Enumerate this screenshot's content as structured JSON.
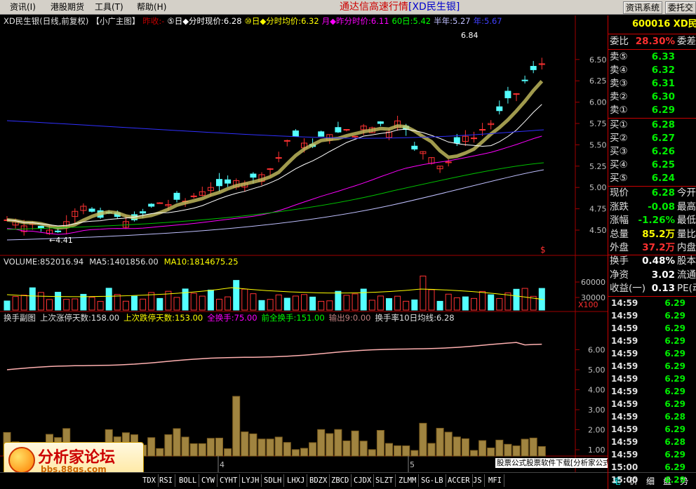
{
  "menubar": {
    "items": [
      "资讯(I)",
      "港股期货",
      "工具(T)",
      "帮助(H)"
    ],
    "app_title": "通达信高速行情",
    "app_title_stock": "[XD民生银]",
    "buttons": [
      "资讯系统",
      "委托交"
    ]
  },
  "chart_header": {
    "stock": "XD民生银(日线,前复权)",
    "template": "【小广主图】",
    "prev_close_label": "昨收:-",
    "fsxj": "⑤日◆分时现价:6.28",
    "fsjj": "⑩日◆分时均价:6.32",
    "zrjj": "月◆昨分时价:6.11",
    "sixty": "60日:5.42",
    "halfyear": "半年:5.27",
    "year": "年:5.67"
  },
  "price_axis": [
    "6.50",
    "6.25",
    "6.00",
    "5.75",
    "5.50",
    "5.25",
    "5.00",
    "4.75",
    "4.50"
  ],
  "annotations": {
    "high": "6.84",
    "low": "4.41",
    "dollar": "$"
  },
  "volume_header": {
    "volume": "VOLUME:852016.94",
    "ma5": "MA5:1401856.00",
    "ma10": "MA10:1814675.25"
  },
  "volume_axis": [
    "60000",
    "30000"
  ],
  "volume_unit": "X100",
  "indicator_header": {
    "name": "换手副图",
    "up": "上次涨停天数:158.00",
    "down": "上次跌停天数:153.00",
    "full": "全换手:75.00",
    "prev_full": "前全换手:151.00",
    "out": "输出9:0.00",
    "rate": "换手率10日均线:6.28"
  },
  "indicator_axis": [
    "6.00",
    "5.00",
    "4.00",
    "3.00",
    "2.00",
    "1.00"
  ],
  "month_markers": [
    "4",
    "5"
  ],
  "tabs": [
    "TDX",
    "RSI",
    "BOLL",
    "CYW",
    "CYHT",
    "LYJH",
    "SDLH",
    "LHXJ",
    "BDZX",
    "ZBCD",
    "CJDX",
    "SLZT",
    "ZLMM",
    "SG-LB",
    "ACCER",
    "JS",
    "MFI"
  ],
  "watermark": {
    "title": "分析家论坛",
    "url": "bbs.88gs.com"
  },
  "promo": "股票公式股票软件下载[分析家公式网www.88gs.com]",
  "quote": {
    "code": "600016 XD民",
    "weibi_label": "委比",
    "weibi": "28.30%",
    "weibi_extra": "委差",
    "asks": [
      {
        "label": "卖⑤",
        "price": "6.33"
      },
      {
        "label": "卖④",
        "price": "6.32"
      },
      {
        "label": "卖③",
        "price": "6.31"
      },
      {
        "label": "卖②",
        "price": "6.30"
      },
      {
        "label": "卖①",
        "price": "6.29"
      }
    ],
    "bids": [
      {
        "label": "买①",
        "price": "6.28"
      },
      {
        "label": "买②",
        "price": "6.27"
      },
      {
        "label": "买③",
        "price": "6.26"
      },
      {
        "label": "买④",
        "price": "6.25"
      },
      {
        "label": "买⑤",
        "price": "6.24"
      }
    ],
    "stats": [
      {
        "label": "现价",
        "value": "6.28",
        "extra": "今开",
        "color": "#00ee00"
      },
      {
        "label": "涨跌",
        "value": "-0.08",
        "extra": "最高",
        "color": "#00ee00"
      },
      {
        "label": "涨幅",
        "value": "-1.26%",
        "extra": "最低",
        "color": "#00ee00"
      },
      {
        "label": "总量",
        "value": "85.2万",
        "extra": "量比",
        "color": "#ffff00"
      },
      {
        "label": "外盘",
        "value": "37.2万",
        "extra": "内盘",
        "color": "#ff3030"
      }
    ],
    "stats2": [
      {
        "label": "换手",
        "value": "0.48%",
        "extra": "股本"
      },
      {
        "label": "净资",
        "value": "3.02",
        "extra": "流通"
      },
      {
        "label": "收益(一)",
        "value": "0.13",
        "extra": "PE(动)"
      }
    ],
    "ticks": [
      {
        "time": "14:59",
        "price": "6.29"
      },
      {
        "time": "14:59",
        "price": "6.29"
      },
      {
        "time": "14:59",
        "price": "6.29"
      },
      {
        "time": "14:59",
        "price": "6.29"
      },
      {
        "time": "14:59",
        "price": "6.29"
      },
      {
        "time": "14:59",
        "price": "6.29"
      },
      {
        "time": "14:59",
        "price": "6.29"
      },
      {
        "time": "14:59",
        "price": "6.29"
      },
      {
        "time": "14:59",
        "price": "6.29"
      },
      {
        "time": "14:59",
        "price": "6.28"
      },
      {
        "time": "14:59",
        "price": "6.29"
      },
      {
        "time": "14:59",
        "price": "6.28"
      },
      {
        "time": "14:59",
        "price": "6.29"
      },
      {
        "time": "15:00",
        "price": "6.29"
      },
      {
        "time": "15:00",
        "price": "6.29"
      }
    ],
    "right_tabs": [
      "笔",
      "价",
      "细",
      "盘",
      "势"
    ]
  },
  "colors": {
    "up": "#ff3232",
    "down": "#54ffff",
    "grid": "#a00000",
    "text": "#c0c0c0"
  }
}
